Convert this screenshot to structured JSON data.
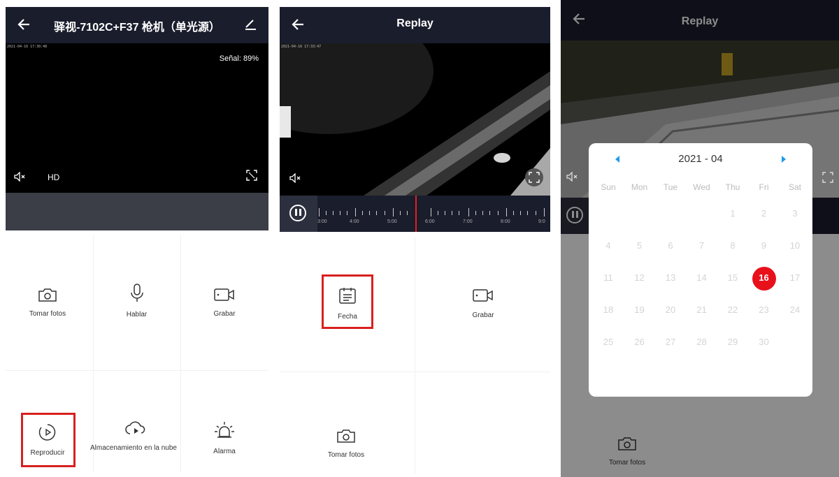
{
  "colors": {
    "topbar": "#1a1d2c",
    "highlight": "#d8201f",
    "calendar_arrow": "#1e9be9",
    "selected_day": "#e8101b"
  },
  "panel1": {
    "title": "驿视-7102C+F37 枪机（单光源）",
    "timestamp": "2021-04-16 17:30:48",
    "signal": "Señal: 89%",
    "quality": "HD",
    "controls": [
      {
        "label": "Tomar fotos",
        "icon": "camera-icon"
      },
      {
        "label": "Hablar",
        "icon": "microphone-icon"
      },
      {
        "label": "Grabar",
        "icon": "video-record-icon"
      },
      {
        "label": "Reproducir",
        "icon": "playback-icon"
      },
      {
        "label": "Almacenamiento en la nube",
        "icon": "cloud-play-icon"
      },
      {
        "label": "Alarma",
        "icon": "alarm-icon"
      }
    ]
  },
  "panel2": {
    "title": "Replay",
    "timestamp": "2021-04-16 17:33:47",
    "timeline_labels": [
      "3:00",
      "4:00",
      "5:00",
      "6:00",
      "7:00",
      "8:00",
      "9:0"
    ],
    "controls": [
      {
        "label": "Fecha",
        "icon": "calendar-icon"
      },
      {
        "label": "Grabar",
        "icon": "video-record-icon"
      },
      {
        "label": "Tomar fotos",
        "icon": "camera-icon"
      }
    ]
  },
  "panel3": {
    "title": "Replay",
    "calendar": {
      "month_label": "2021 - 04",
      "weekdays": [
        "Sun",
        "Mon",
        "Tue",
        "Wed",
        "Thu",
        "Fri",
        "Sat"
      ],
      "weeks": [
        [
          "",
          "",
          "",
          "",
          "1",
          "2",
          "3"
        ],
        [
          "4",
          "5",
          "6",
          "7",
          "8",
          "9",
          "10"
        ],
        [
          "11",
          "12",
          "13",
          "14",
          "15",
          "16",
          "17"
        ],
        [
          "18",
          "19",
          "20",
          "21",
          "22",
          "23",
          "24"
        ],
        [
          "25",
          "26",
          "27",
          "28",
          "29",
          "30",
          ""
        ]
      ],
      "selected_day": "16"
    },
    "bottom_control": {
      "label": "Tomar fotos",
      "icon": "camera-icon"
    }
  }
}
